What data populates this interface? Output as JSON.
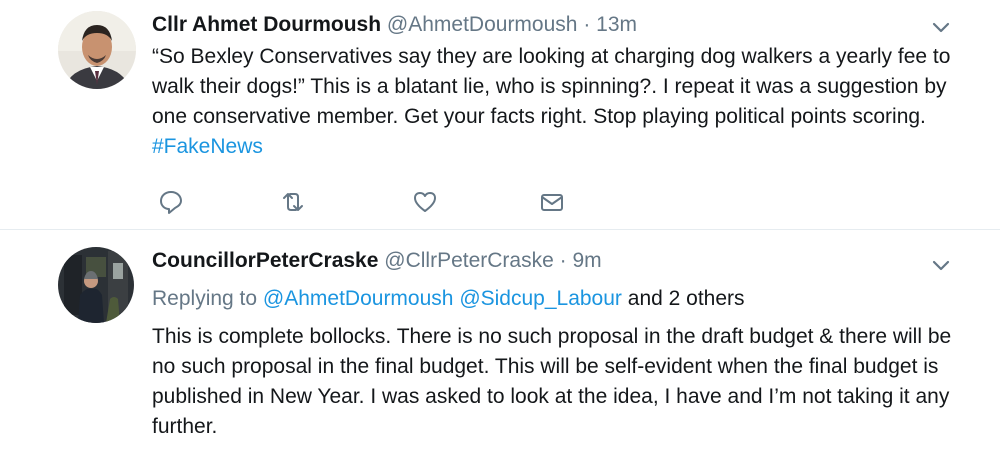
{
  "tweets": [
    {
      "name": "Cllr Ahmet Dourmoush",
      "handle": "@AhmetDourmoush",
      "dot": "·",
      "time": "13m",
      "text_plain": "“So Bexley Conservatives say they are looking at charging dog walkers a yearly fee to walk their dogs!” This is a blatant lie, who is spinning?. I repeat it was a suggestion by one conservative member. Get your facts right. Stop playing political points scoring.",
      "hashtag": "#FakeNews",
      "actions": {
        "reply_icon": "reply-icon",
        "retweet_icon": "retweet-icon",
        "like_icon": "heart-icon",
        "dm_icon": "envelope-icon"
      }
    },
    {
      "name": "CouncillorPeterCraske",
      "handle": "@CllrPeterCraske",
      "dot": "·",
      "time": "9m",
      "replying_prefix": "Replying to",
      "replying_mention_1": "@AhmetDourmoush",
      "replying_mention_2": "@Sidcup_Labour",
      "replying_suffix": "and 2 others",
      "text": "This is complete bollocks. There is no such proposal in the draft budget & there will be no such proposal in the final budget. This will be self-evident when the final budget is published in New Year. I was asked to look at the idea, I have and I’m not taking it any further."
    }
  ],
  "colors": {
    "link": "#1b95e0",
    "secondary_text": "#657786",
    "divider": "#e6ecf0"
  }
}
